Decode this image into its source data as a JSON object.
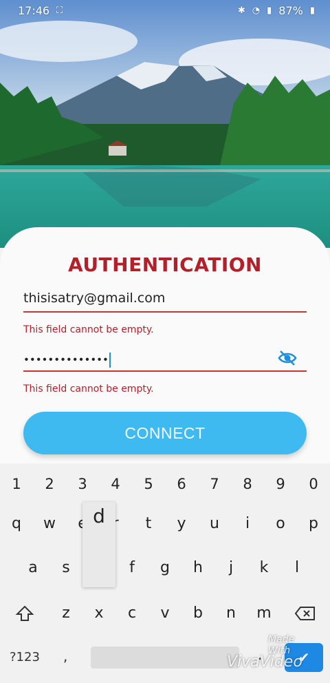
{
  "status_bar": {
    "time": "17:46",
    "battery": "87%",
    "icons": [
      "screenshot-icon",
      "bluetooth-icon",
      "wifi-icon",
      "signal-icon",
      "battery-icon"
    ]
  },
  "auth": {
    "title": "AUTHENTICATION",
    "email_value": "thisisatry@gmail.com",
    "email_error": "This field cannot be empty.",
    "password_value": "••••••••••••••",
    "password_error": "This field cannot be empty.",
    "connect_label": "CONNECT"
  },
  "colors": {
    "accent_red": "#b3202a",
    "button_blue": "#3fbaf0",
    "eye_blue": "#1f8fdb"
  },
  "keyboard": {
    "row_numbers": [
      "1",
      "2",
      "3",
      "4",
      "5",
      "6",
      "7",
      "8",
      "9",
      "0"
    ],
    "row_top": [
      "q",
      "w",
      "e",
      "r",
      "t",
      "y",
      "u",
      "i",
      "o",
      "p"
    ],
    "row_middle": [
      "a",
      "s",
      "d",
      "f",
      "g",
      "h",
      "j",
      "k",
      "l"
    ],
    "row_bottom": [
      "z",
      "x",
      "c",
      "v",
      "b",
      "n",
      "m"
    ],
    "pressed_key": "d",
    "symbols_label": "?123",
    "comma": ",",
    "period": "."
  },
  "watermark": {
    "line1": "Made With",
    "line2": "VivaVideo"
  }
}
